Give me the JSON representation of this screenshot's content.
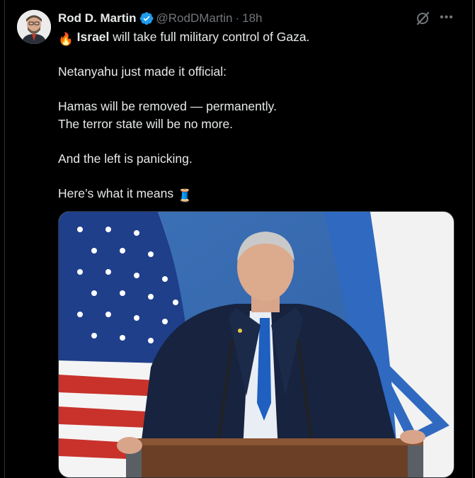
{
  "author": {
    "display_name": "Rod D. Martin",
    "handle": "@RodDMartin",
    "separator": "·",
    "time": "18h",
    "verified": true,
    "avatar_icon": "profile-photo"
  },
  "actions": {
    "grok_icon": "grok-icon",
    "more_icon": "more-options-icon",
    "more_label": "•••"
  },
  "post": {
    "line1_emoji": "🔥",
    "line1_bold": "Israel",
    "line1_rest": " will take full military control of Gaza.",
    "line2": "Netanyahu just made it official:",
    "line3": "Hamas will be removed — permanently.",
    "line4": "The terror state will be no more.",
    "line5": "And the left is panicking.",
    "line6": "Here’s what it means",
    "line6_emoji": "🧵"
  },
  "media": {
    "description_icon": "photo-netanyahu-podium-flags",
    "colors": {
      "background_blue": "#3a6fb3",
      "suit": "#17233f",
      "tie": "#1f5fbf",
      "podium": "#6b3f25"
    }
  },
  "colors": {
    "background": "#000000",
    "text": "#e7e9ea",
    "secondary": "#71767b",
    "verified": "#1d9bf0"
  }
}
